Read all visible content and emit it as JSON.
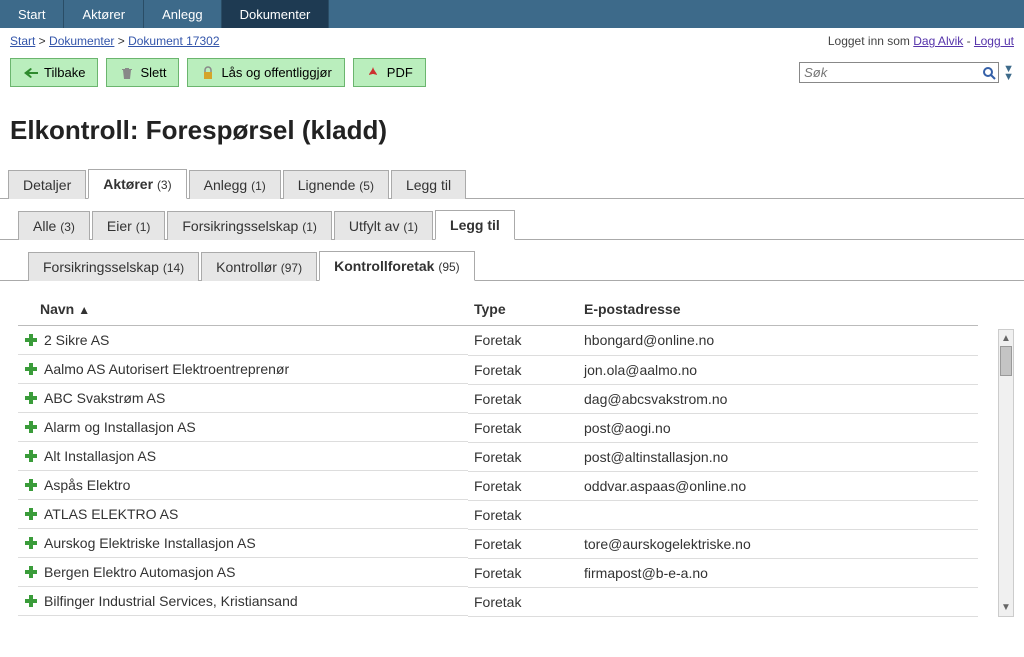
{
  "topnav": [
    {
      "label": "Start",
      "active": false
    },
    {
      "label": "Aktører",
      "active": false
    },
    {
      "label": "Anlegg",
      "active": false
    },
    {
      "label": "Dokumenter",
      "active": true
    }
  ],
  "breadcrumb": {
    "items": [
      "Start",
      "Dokumenter",
      "Dokument 17302"
    ],
    "sep": " > "
  },
  "login": {
    "prefix": "Logget inn som ",
    "user": "Dag Alvik",
    "sep": " - ",
    "logout": "Logg ut"
  },
  "actions": {
    "back": "Tilbake",
    "delete": "Slett",
    "lock": "Lås og offentliggjør",
    "pdf": "PDF"
  },
  "search": {
    "placeholder": "Søk"
  },
  "page_title": "Elkontroll: Forespørsel (kladd)",
  "tabs_main": [
    {
      "label": "Detaljer",
      "count": "",
      "active": false
    },
    {
      "label": "Aktører",
      "count": "(3)",
      "active": true
    },
    {
      "label": "Anlegg",
      "count": "(1)",
      "active": false
    },
    {
      "label": "Lignende",
      "count": "(5)",
      "active": false
    },
    {
      "label": "Legg til",
      "count": "",
      "active": false
    }
  ],
  "tabs_sub1": [
    {
      "label": "Alle",
      "count": "(3)",
      "active": false
    },
    {
      "label": "Eier",
      "count": "(1)",
      "active": false
    },
    {
      "label": "Forsikringsselskap",
      "count": "(1)",
      "active": false
    },
    {
      "label": "Utfylt av",
      "count": "(1)",
      "active": false
    },
    {
      "label": "Legg til",
      "count": "",
      "active": true
    }
  ],
  "tabs_sub2": [
    {
      "label": "Forsikringsselskap",
      "count": "(14)",
      "active": false
    },
    {
      "label": "Kontrollør",
      "count": "(97)",
      "active": false
    },
    {
      "label": "Kontrollforetak",
      "count": "(95)",
      "active": true
    }
  ],
  "table": {
    "columns": {
      "name": "Navn",
      "type": "Type",
      "email": "E-postadresse"
    },
    "sort_indicator": "▲",
    "rows": [
      {
        "name": "2 Sikre AS",
        "type": "Foretak",
        "email": "hbongard@online.no"
      },
      {
        "name": "Aalmo AS Autorisert Elektroentreprenør",
        "type": "Foretak",
        "email": "jon.ola@aalmo.no"
      },
      {
        "name": "ABC Svakstrøm AS",
        "type": "Foretak",
        "email": "dag@abcsvakstrom.no"
      },
      {
        "name": "Alarm og Installasjon AS",
        "type": "Foretak",
        "email": "post@aogi.no"
      },
      {
        "name": "Alt Installasjon AS",
        "type": "Foretak",
        "email": "post@altinstallasjon.no"
      },
      {
        "name": "Aspås Elektro",
        "type": "Foretak",
        "email": "oddvar.aspaas@online.no"
      },
      {
        "name": "ATLAS ELEKTRO AS",
        "type": "Foretak",
        "email": ""
      },
      {
        "name": "Aurskog Elektriske Installasjon AS",
        "type": "Foretak",
        "email": "tore@aurskogelektriske.no"
      },
      {
        "name": "Bergen Elektro Automasjon AS",
        "type": "Foretak",
        "email": "firmapost@b-e-a.no"
      },
      {
        "name": "Bilfinger Industrial Services, Kristiansand",
        "type": "Foretak",
        "email": ""
      }
    ]
  }
}
